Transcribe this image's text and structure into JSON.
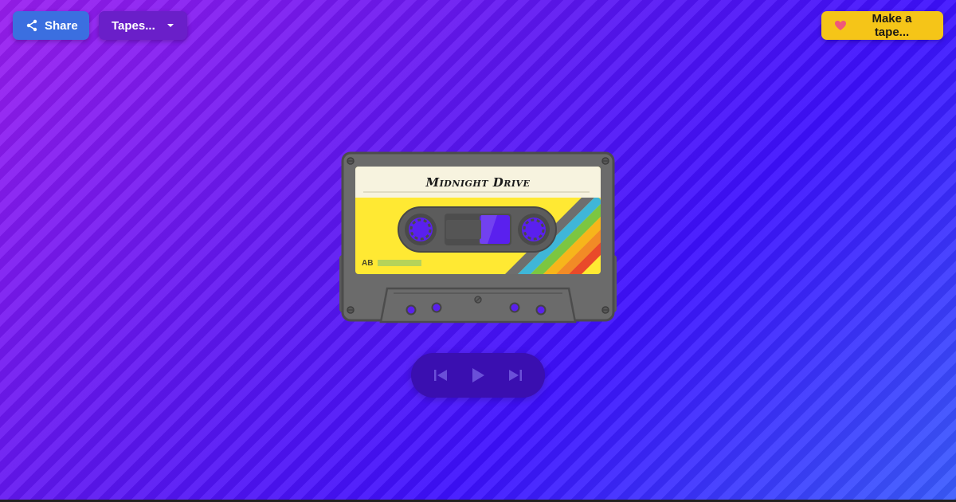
{
  "header": {
    "share_label": "Share",
    "tapes_label": "Tapes...",
    "make_label": "Make a tape..."
  },
  "tape": {
    "title": "Midnight Drive",
    "side": "AB"
  },
  "icons": {
    "share": "share-icon",
    "caret": "caret-down-icon",
    "heart": "heart-icon",
    "prev": "skip-previous-icon",
    "play": "play-icon",
    "next": "skip-next-icon"
  },
  "colors": {
    "share_button": "#3b6fe0",
    "tapes_button": "#6a1fc9",
    "make_button": "#f5c518",
    "heart": "#f0587a",
    "label_yellow": "#ffe933",
    "label_cream": "#f7f3df",
    "cassette_body": "#6b6b6b",
    "controls_bg": "#3a0fb0"
  }
}
